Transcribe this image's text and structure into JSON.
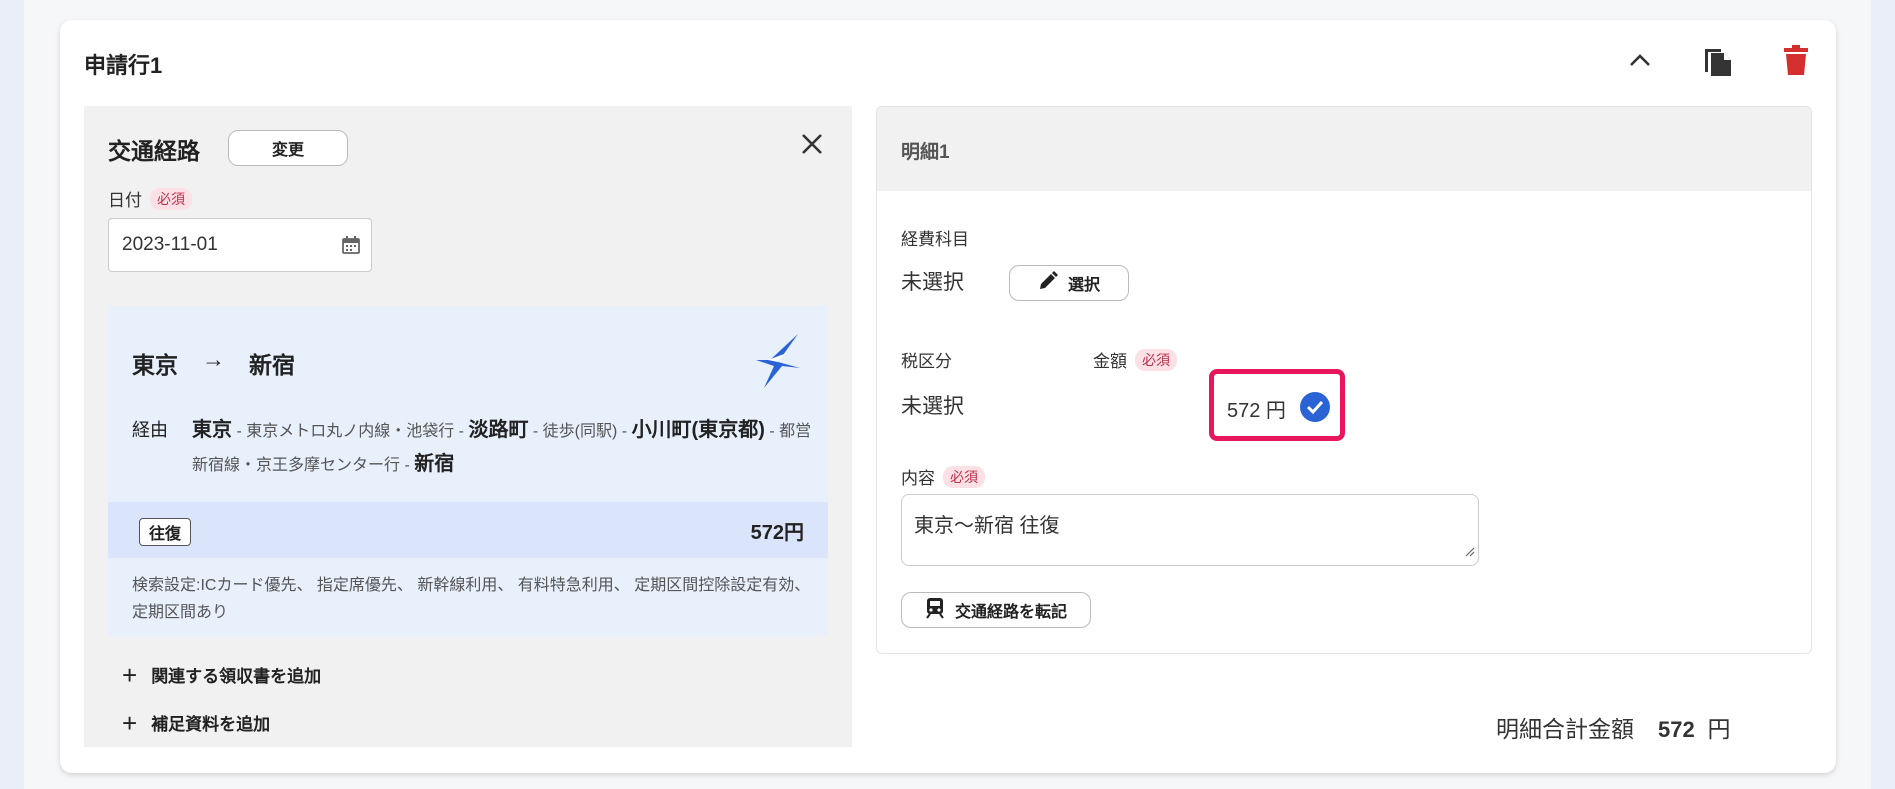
{
  "card": {
    "title": "申請行1",
    "icons": [
      "chevron-up-icon",
      "copy-icon",
      "trash-icon"
    ]
  },
  "route": {
    "section_title": "交通経路",
    "change_label": "変更",
    "date_label": "日付",
    "required": "必須",
    "date_value": "2023-11-01",
    "from": "東京",
    "arrow": "→",
    "to": "新宿",
    "via_label": "経由",
    "via": {
      "s1": "東京",
      "l1": " - 東京メトロ丸ノ内線・池袋行 - ",
      "s2": "淡路町",
      "l2": " - 徒歩(同駅) - ",
      "s3": "小川町(東京都)",
      "l3": " - 都営新宿線・京王多摩センター行 - ",
      "s4": "新宿"
    },
    "round_trip": "往復",
    "fare": "572円",
    "search_settings": "検索設定:ICカード優先、 指定席優先、 新幹線利用、 有料特急利用、 定期区間控除設定有効、 定期区間あり",
    "add_receipt": "関連する領収書を追加",
    "add_material": "補足資料を追加"
  },
  "detail": {
    "title": "明細1",
    "expense_label": "経費科目",
    "expense_value": "未選択",
    "select_label": "選択",
    "tax_label": "税区分",
    "tax_value": "未選択",
    "amount_label": "金額",
    "required": "必須",
    "amount_value": "572 円",
    "content_label": "内容",
    "content_value": "東京～新宿 往復",
    "transcribe_label": "交通経路を転記"
  },
  "total": {
    "label": "明細合計金額",
    "value": "572",
    "unit": "円"
  },
  "colors": {
    "accent_blue": "#2a63d6",
    "highlight": "#e8175d",
    "delete_red": "#d32f2f"
  }
}
